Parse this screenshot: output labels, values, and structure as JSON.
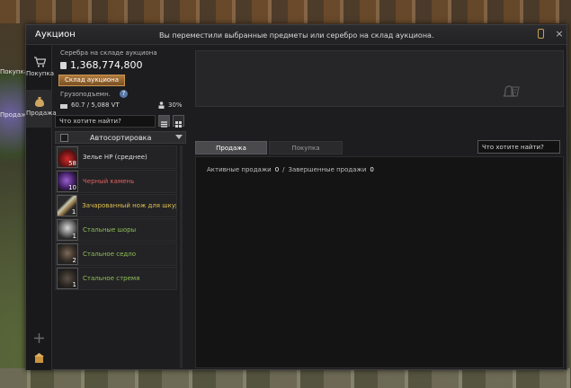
{
  "outside": {
    "tab_buy": "Покупка",
    "tab_sell": "Продажа"
  },
  "window": {
    "title": "Аукцион",
    "notice": "Вы переместили выбранные предметы или серебро на склад аукциона.",
    "close": "×"
  },
  "sidebar": {
    "items": [
      {
        "label": "Покупка",
        "icon": "cart-icon"
      },
      {
        "label": "Продажа",
        "icon": "moneybag-icon"
      }
    ]
  },
  "wallet": {
    "label": "Серебра на складе аукциона",
    "value": "1,368,774,800",
    "warehouse_button": "Склад аукциона"
  },
  "weight": {
    "label": "Грузоподъемн.",
    "help": "?",
    "value": "60.7 / 5,088 VT",
    "percent": "30%"
  },
  "search": {
    "placeholder": "Что хотите найти?"
  },
  "autosort": {
    "label": "Автосортировка"
  },
  "items": [
    {
      "name": "Зелье HP (среднее)",
      "qty": "58",
      "color": "white"
    },
    {
      "name": "Черный камень",
      "qty": "10",
      "color": "red"
    },
    {
      "name": "Зачарованный нож для шкур",
      "qty": "1",
      "color": "yellow"
    },
    {
      "name": "Стальные шоры",
      "qty": "1",
      "color": "green"
    },
    {
      "name": "Стальное седло",
      "qty": "2",
      "color": "green"
    },
    {
      "name": "Стальное стремя",
      "qty": "1",
      "color": "green"
    }
  ],
  "tabs": {
    "sell": "Продажа",
    "buy": "Покупка",
    "search_placeholder": "Что хотите найти?"
  },
  "sales": {
    "active_label": "Активные продажи",
    "active_count": "0",
    "separator": "/",
    "completed_label": "Завершенные продажи",
    "completed_count": "0"
  },
  "colors": {
    "accent": "#b07a3c",
    "item_white": "#dedede",
    "item_red": "#e06060",
    "item_yellow": "#e2c14f",
    "item_green": "#8fbf58"
  }
}
